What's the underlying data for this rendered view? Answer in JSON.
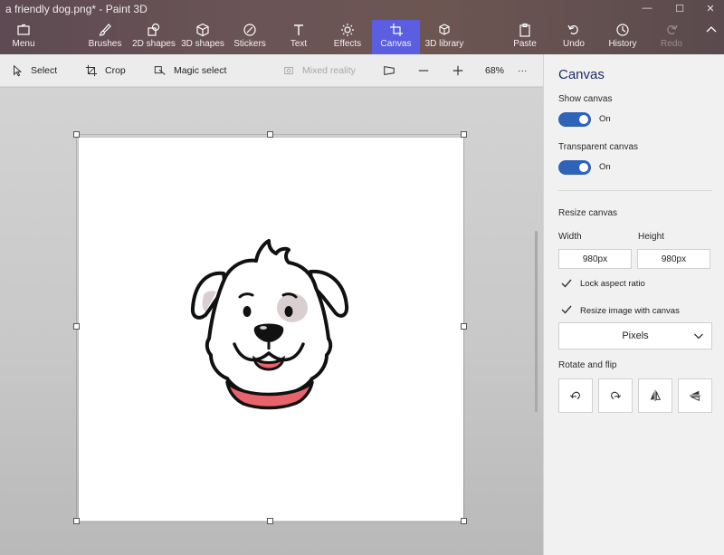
{
  "window": {
    "title": "a friendly dog.png* - Paint 3D"
  },
  "ribbon": {
    "menu": "Menu",
    "tools": [
      {
        "label": "Brushes",
        "icon": "brush-icon"
      },
      {
        "label": "2D shapes",
        "icon": "shapes-2d-icon"
      },
      {
        "label": "3D shapes",
        "icon": "cube-icon"
      },
      {
        "label": "Stickers",
        "icon": "sticker-icon"
      },
      {
        "label": "Text",
        "icon": "text-icon"
      },
      {
        "label": "Effects",
        "icon": "sun-icon"
      },
      {
        "label": "Canvas",
        "icon": "canvas-icon",
        "active": true
      },
      {
        "label": "3D library",
        "icon": "library-icon"
      }
    ],
    "paste": "Paste",
    "undo": "Undo",
    "history": "History",
    "redo": "Redo"
  },
  "toolbar": {
    "select": "Select",
    "crop": "Crop",
    "magic_select": "Magic select",
    "mixed_reality": "Mixed reality",
    "zoom": "68%",
    "more": "···"
  },
  "panel": {
    "title": "Canvas",
    "show_canvas": {
      "label": "Show canvas",
      "state": "On"
    },
    "transparent_canvas": {
      "label": "Transparent canvas",
      "state": "On"
    },
    "resize_label": "Resize canvas",
    "width_label": "Width",
    "height_label": "Height",
    "width_value": "980px",
    "height_value": "980px",
    "lock_aspect": "Lock aspect ratio",
    "resize_with_canvas": "Resize image with canvas",
    "units": "Pixels",
    "rotate_flip_label": "Rotate and flip"
  },
  "colors": {
    "accent": "#5b5ee0",
    "toggle": "#2d63b8",
    "panel_title": "#1e2a6a",
    "collar": "#e8636b",
    "tongue": "#e8636b"
  }
}
